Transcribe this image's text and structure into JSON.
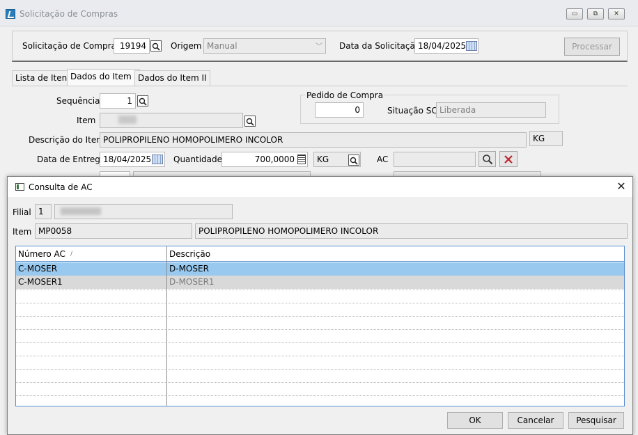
{
  "bg": {
    "window_title": "Solicitação de Compras",
    "win_buttons": [
      "▭",
      "⧉",
      "✕"
    ],
    "header": {
      "solicitacao_label": "Solicitação de Compras",
      "solicitacao_value": "19194",
      "origem_label": "Origem",
      "origem_value": "Manual",
      "data_label": "Data da Solicitação",
      "data_value": "18/04/2025",
      "processar_label": "Processar"
    },
    "tabs": [
      "Lista de Itens",
      "Dados do Item I",
      "Dados do Item II"
    ],
    "form": {
      "sequencia_label": "Sequência",
      "sequencia_value": "1",
      "item_label": "Item",
      "pedido_group_label": "Pedido de Compra",
      "pedido_value": "0",
      "situacao_label": "Situação SC",
      "situacao_value": "Liberada",
      "descricao_label": "Descrição do Item",
      "descricao_value": "POLIPROPILENO HOMOPOLIMERO INCOLOR",
      "unidade_value": "KG",
      "entrega_label": "Data de Entrega",
      "entrega_value": "18/04/2025",
      "quantidade_label": "Quantidade",
      "quantidade_value": "700,0000",
      "unidade2_value": "KG",
      "ac_label": "AC"
    }
  },
  "dialog": {
    "title": "Consulta de AC",
    "close_glyph": "✕",
    "filial_label": "Filial",
    "filial_value": "1",
    "item_label": "Item",
    "item_code": "MP0058",
    "item_desc": "POLIPROPILENO HOMOPOLIMERO INCOLOR",
    "grid": {
      "columns": [
        "Número AC",
        "Descrição"
      ],
      "sort_glyph": "/",
      "rows": [
        {
          "numero": "C-MOSER",
          "descricao": "D-MOSER",
          "selected": true
        },
        {
          "numero": "C-MOSER1",
          "descricao": "D-MOSER1",
          "selected": false
        }
      ]
    },
    "buttons": {
      "ok": "OK",
      "cancelar": "Cancelar",
      "pesquisar": "Pesquisar"
    }
  },
  "colors": {
    "selected_row": "#99c9ef",
    "grid_border": "#5b8fd0",
    "delete_red": "#c0262d"
  }
}
